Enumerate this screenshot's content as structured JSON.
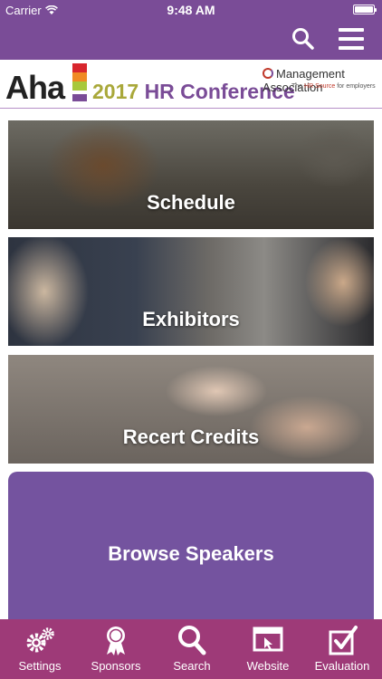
{
  "status": {
    "carrier": "Carrier",
    "time": "9:48 AM"
  },
  "nav": {
    "search_icon": "search-icon",
    "menu_icon": "hamburger-menu-icon"
  },
  "banner": {
    "aha": "Aha",
    "year": "2017",
    "conference": "HR Conference",
    "org": "Management Association",
    "tagline_prefix": "The",
    "tagline_highlight": "HR Source",
    "tagline_suffix": "for employers"
  },
  "tiles": [
    {
      "label": "Schedule"
    },
    {
      "label": "Exhibitors"
    },
    {
      "label": "Recert Credits"
    },
    {
      "label": "Browse Speakers"
    }
  ],
  "tabbar": [
    {
      "label": "Settings",
      "icon": "gears-icon"
    },
    {
      "label": "Sponsors",
      "icon": "ribbon-icon"
    },
    {
      "label": "Search",
      "icon": "search-icon"
    },
    {
      "label": "Website",
      "icon": "browser-window-icon"
    },
    {
      "label": "Evaluation",
      "icon": "checkbox-icon"
    }
  ],
  "colors": {
    "header": "#7a4c97",
    "tabbar": "#9e3a78",
    "speakers_tile": "#74539f"
  }
}
